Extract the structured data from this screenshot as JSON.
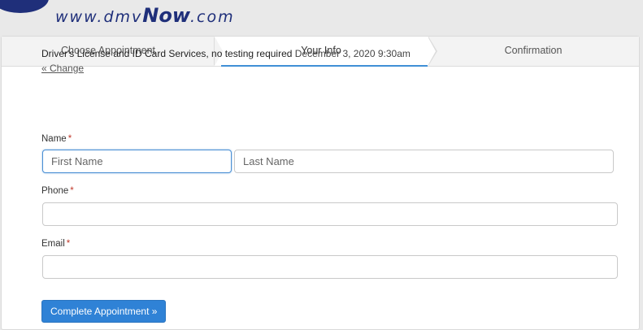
{
  "logo": {
    "url_prefix": "www.dmv",
    "url_now": "Now",
    "url_suffix": ".com"
  },
  "steps": [
    {
      "label": "Choose Appointment"
    },
    {
      "label": "Your Info"
    },
    {
      "label": "Confirmation"
    }
  ],
  "appointment": {
    "service": "Driver's License and ID Card Services, no testing required",
    "datetime": "December 3, 2020 9:30am",
    "change_link": "« Change"
  },
  "form": {
    "name_label": "Name",
    "first_name_placeholder": "First Name",
    "last_name_placeholder": "Last Name",
    "phone_label": "Phone",
    "phone_value": "",
    "email_label": "Email",
    "email_value": "",
    "required_marker": "*",
    "submit_label": "Complete Appointment »"
  },
  "colors": {
    "brand": "#1f2f7a",
    "accent": "#2f82d6",
    "required": "#c0392b"
  }
}
